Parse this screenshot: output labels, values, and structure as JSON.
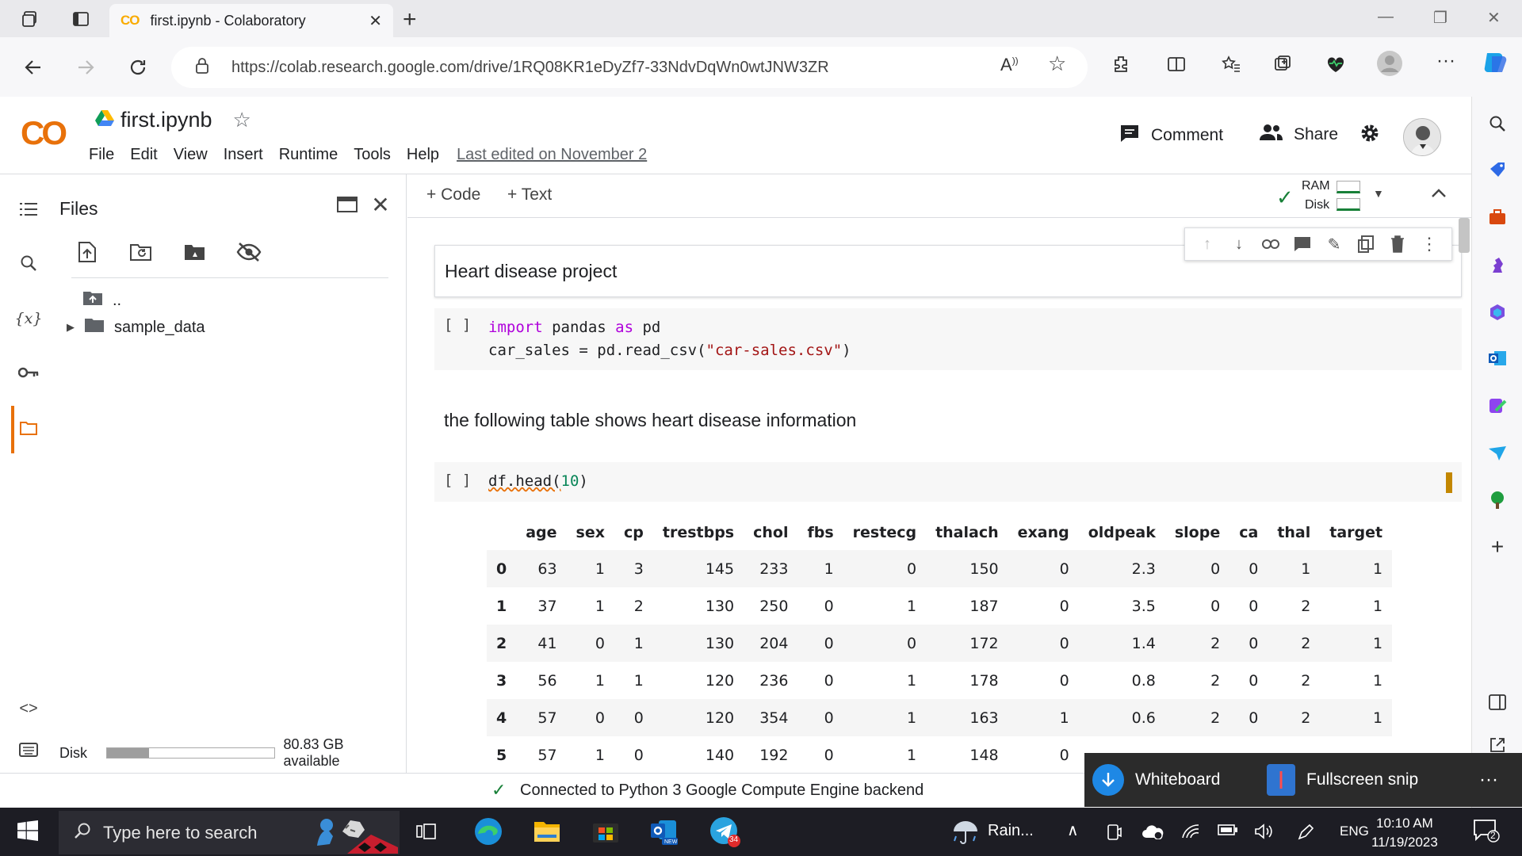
{
  "browser": {
    "tab_title": "first.ipynb - Colaboratory",
    "tab_favicon": "CO",
    "url": "https://colab.research.google.com/drive/1RQ08KR1eDyZf7-33NdvDqWn0wtJNW3ZR"
  },
  "colab": {
    "logo": "CO",
    "notebook_title": "first.ipynb",
    "menu": [
      "File",
      "Edit",
      "View",
      "Insert",
      "Runtime",
      "Tools",
      "Help"
    ],
    "last_edited": "Last edited on November 2",
    "comment_label": "Comment",
    "share_label": "Share"
  },
  "files_panel": {
    "title": "Files",
    "parent_dir": "..",
    "folder": "sample_data",
    "disk_label": "Disk",
    "disk_available": "80.83 GB available",
    "disk_used_fraction": 0.25
  },
  "notebook_toolbar": {
    "add_code": "+ Code",
    "add_text": "+ Text",
    "ram_label": "RAM",
    "disk_label": "Disk"
  },
  "cells": {
    "md1": "Heart disease project",
    "code1_bracket": "[ ]",
    "code1_line1_kw1": "import",
    "code1_line1_mod": " pandas ",
    "code1_line1_kw2": "as",
    "code1_line1_alias": " pd",
    "code1_line2_pre": "car_sales = pd.read_csv(",
    "code1_line2_str": "\"car-sales.csv\"",
    "code1_line2_post": ")",
    "md2": "the following table shows heart disease information",
    "code2_bracket": "[ ]",
    "code2_pre": "df.head(",
    "code2_num": "10",
    "code2_post": ")"
  },
  "table": {
    "columns": [
      "",
      "age",
      "sex",
      "cp",
      "trestbps",
      "chol",
      "fbs",
      "restecg",
      "thalach",
      "exang",
      "oldpeak",
      "slope",
      "ca",
      "thal",
      "target"
    ],
    "rows": [
      [
        "0",
        "63",
        "1",
        "3",
        "145",
        "233",
        "1",
        "0",
        "150",
        "0",
        "2.3",
        "0",
        "0",
        "1",
        "1"
      ],
      [
        "1",
        "37",
        "1",
        "2",
        "130",
        "250",
        "0",
        "1",
        "187",
        "0",
        "3.5",
        "0",
        "0",
        "2",
        "1"
      ],
      [
        "2",
        "41",
        "0",
        "1",
        "130",
        "204",
        "0",
        "0",
        "172",
        "0",
        "1.4",
        "2",
        "0",
        "2",
        "1"
      ],
      [
        "3",
        "56",
        "1",
        "1",
        "120",
        "236",
        "0",
        "1",
        "178",
        "0",
        "0.8",
        "2",
        "0",
        "2",
        "1"
      ],
      [
        "4",
        "57",
        "0",
        "0",
        "120",
        "354",
        "0",
        "1",
        "163",
        "1",
        "0.6",
        "2",
        "0",
        "2",
        "1"
      ],
      [
        "5",
        "57",
        "1",
        "0",
        "140",
        "192",
        "0",
        "1",
        "148",
        "0",
        "",
        "",
        "",
        "",
        ""
      ]
    ]
  },
  "status": {
    "connected": "Connected to Python 3 Google Compute Engine backend"
  },
  "popup": {
    "whiteboard": "Whiteboard",
    "snip": "Fullscreen snip",
    "more": "···"
  },
  "taskbar": {
    "search_placeholder": "Type here to search",
    "weather": "Rain...",
    "language": "ENG",
    "time": "10:10 AM",
    "date": "11/19/2023",
    "telegram_badge": "34",
    "notif_count": "2"
  },
  "colors": {
    "colab_orange": "#e8710a",
    "colab_yellow": "#f9ab00",
    "keyword": "#af00db",
    "string": "#a31515",
    "number": "#098658",
    "connected_green": "#188038"
  }
}
